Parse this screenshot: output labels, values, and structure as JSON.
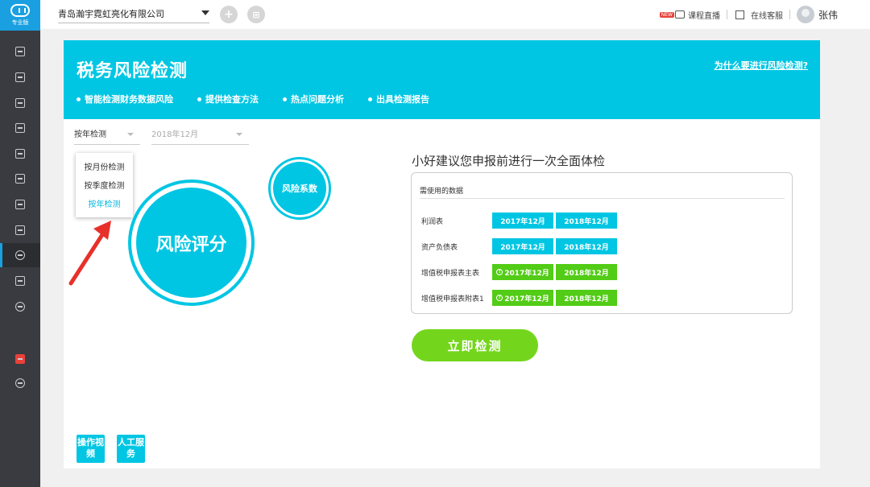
{
  "sidebar": {
    "logo_label": "专业版",
    "icons": [
      "list-icon",
      "invoice-icon",
      "chart-icon",
      "document-icon",
      "calendar-icon",
      "ledger-icon",
      "tax-icon",
      "report-icon",
      "risk-icon",
      "receipt-icon",
      "settings-icon",
      "gift-icon",
      "link-icon"
    ],
    "active": "risk-icon"
  },
  "topbar": {
    "company_name": "青岛瀚宇霓虹亮化有限公司",
    "add_glyph": "+",
    "apps_glyph": "⊞",
    "new_badge": "NEW",
    "live_label": "课程直播",
    "support_label": "在线客服",
    "user_name": "张伟"
  },
  "banner": {
    "title": "税务风险检测",
    "why_link": "为什么要进行风险检测?",
    "steps": [
      "智能检测财务数据风险",
      "提供检查方法",
      "热点问题分析",
      "出具检测报告"
    ]
  },
  "filters": {
    "mode_selected": "按年检测",
    "period_selected": "2018年12月",
    "mode_options": [
      "按月份检测",
      "按季度检测",
      "按年检测"
    ],
    "mode_active_index": 2
  },
  "bubbles": {
    "big": "风险评分",
    "small": "风险系数"
  },
  "data_panel": {
    "suggestion": "小好建议您申报前进行一次全面体检",
    "header": "需使用的数据",
    "warn_glyph": "!",
    "rows": [
      {
        "name": "利润表",
        "p1": "2017年12月",
        "p2": "2018年12月",
        "color": "blue"
      },
      {
        "name": "资产负债表",
        "p1": "2017年12月",
        "p2": "2018年12月",
        "color": "blue"
      },
      {
        "name": "增值税申报表主表",
        "p1": "2017年12月",
        "p2": "2018年12月",
        "color": "green"
      },
      {
        "name": "增值税申报表附表1",
        "p1": "2017年12月",
        "p2": "2018年12月",
        "color": "green"
      }
    ]
  },
  "actions": {
    "check_now": "立即检测",
    "video_help": "操作视频",
    "manual_service": "人工服务"
  },
  "colors": {
    "accent": "#00c6e3",
    "green": "#52cc16",
    "button_green": "#74d61c",
    "rail": "#3a3b40",
    "annotation_arrow": "#e8302a"
  }
}
